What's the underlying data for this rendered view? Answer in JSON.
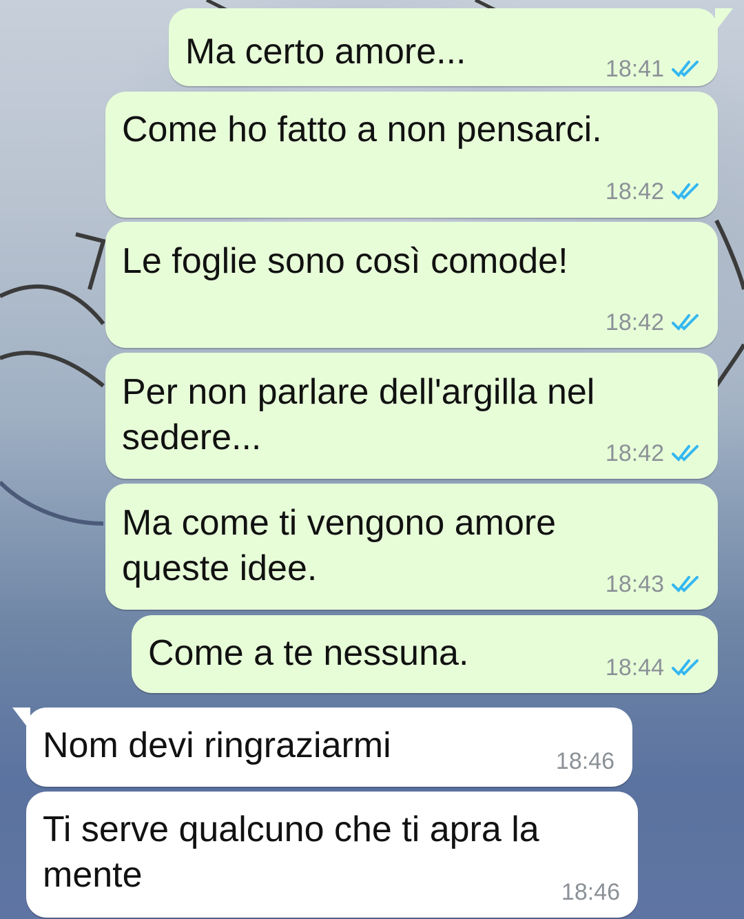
{
  "chat": {
    "messages": [
      {
        "direction": "out",
        "text": "Ma certo amore...",
        "time": "18:41",
        "status": "read"
      },
      {
        "direction": "out",
        "text": "Come ho fatto a non pensarci.",
        "time": "18:42",
        "status": "read"
      },
      {
        "direction": "out",
        "text": "Le foglie sono così comode!",
        "time": "18:42",
        "status": "read"
      },
      {
        "direction": "out",
        "text": "Per non parlare dell'argilla nel\nsedere...",
        "time": "18:42",
        "status": "read"
      },
      {
        "direction": "out",
        "text": "Ma come ti vengono amore\nqueste idee.",
        "time": "18:43",
        "status": "read"
      },
      {
        "direction": "out",
        "text": "Come a te nessuna.",
        "time": "18:44",
        "status": "read"
      },
      {
        "direction": "in",
        "text": "Nom devi ringraziarmi",
        "time": "18:46"
      },
      {
        "direction": "in",
        "text": "Ti serve qualcuno che ti apra la\nmente",
        "time": "18:46"
      }
    ]
  },
  "colors": {
    "outgoing_bubble": "#e7fdd8",
    "incoming_bubble": "#ffffff",
    "read_ticks": "#34b7f1",
    "timestamp": "#8b9197"
  },
  "icons": {
    "read_status": "double-check-icon"
  }
}
